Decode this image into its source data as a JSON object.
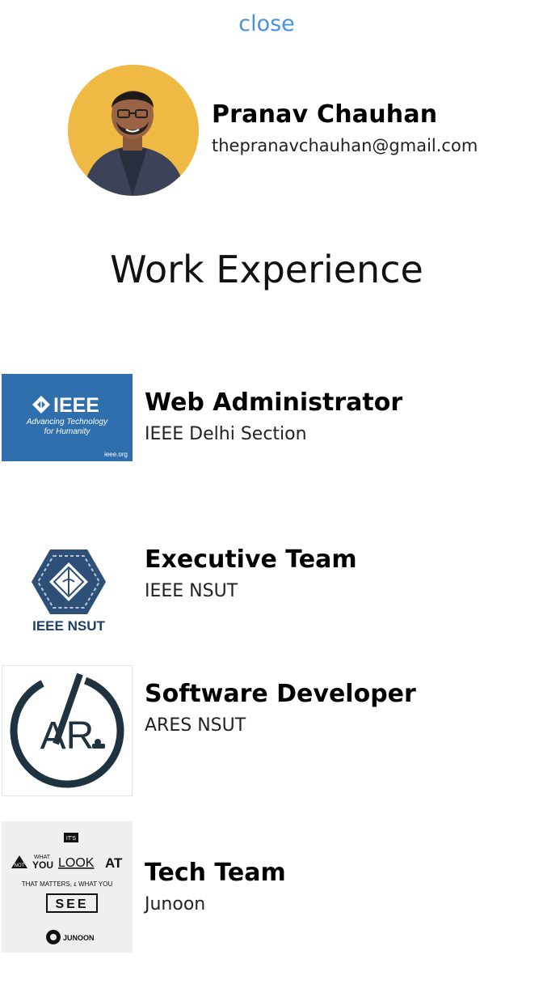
{
  "header": {
    "close_label": "close"
  },
  "profile": {
    "name": "Pranav Chauhan",
    "email": "thepranavchauhan@gmail.com"
  },
  "section": {
    "title": "Work Experience"
  },
  "experiences": [
    {
      "role": "Web Administrator",
      "org": "IEEE Delhi Section",
      "logo": {
        "brand": "IEEE",
        "tagline1": "Advancing Technology",
        "tagline2": "for Humanity",
        "url": "ieee.org",
        "color": "#2f6fae"
      }
    },
    {
      "role": "Executive Team",
      "org": "IEEE NSUT",
      "logo": {
        "text": "IEEE NSUT",
        "color": "#1f3f66"
      }
    },
    {
      "role": "Software Developer",
      "org": "ARES NSUT",
      "logo": {
        "text": "AR",
        "color": "#1f3240"
      }
    },
    {
      "role": "Tech Team",
      "org": "Junoon",
      "logo": {
        "its": "IT'S",
        "not": "NOT",
        "what": "WHAT",
        "you": "YOU",
        "look": "LOOK",
        "at": "AT",
        "line3": "THAT MATTERS, ε WHAT YOU",
        "see": "SEE",
        "brand": "JUNOON"
      }
    }
  ]
}
